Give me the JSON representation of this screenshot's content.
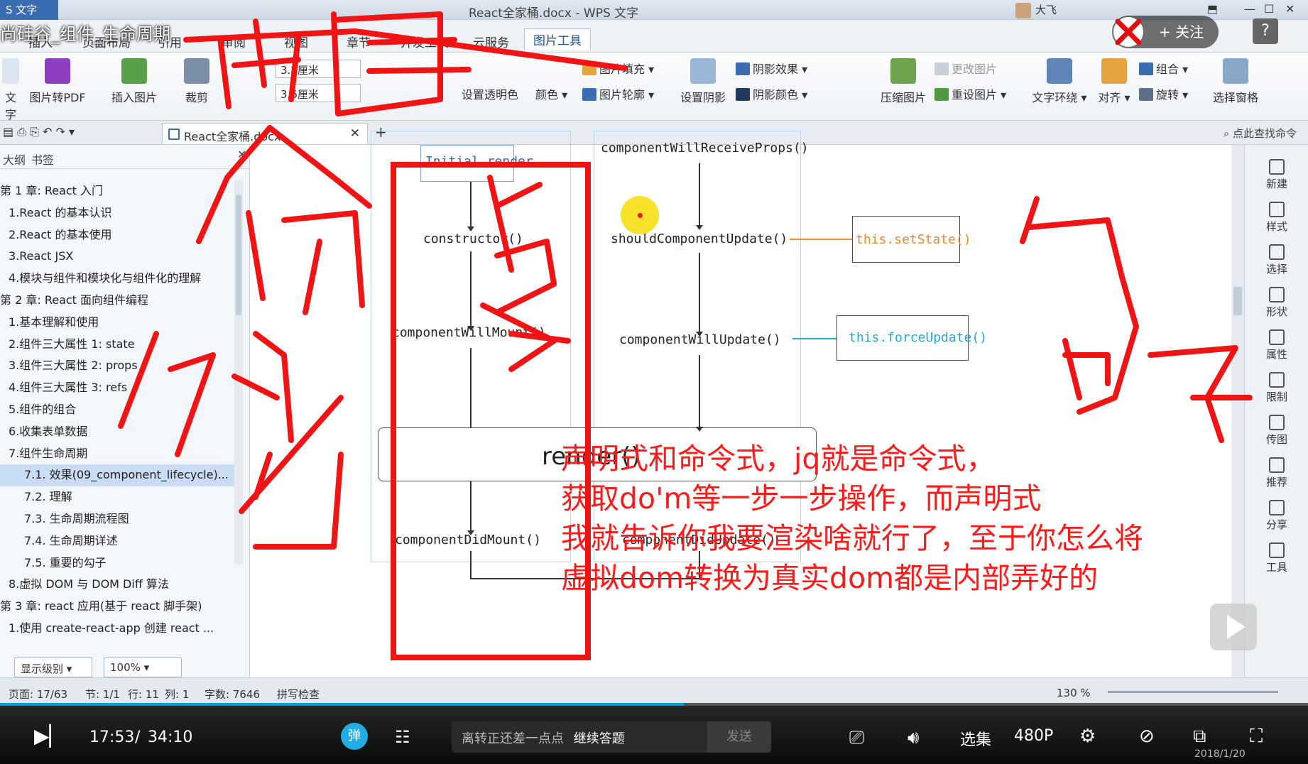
{
  "app": {
    "app_button": "S 文字",
    "doc_title": "React全家桶.docx - WPS 文字",
    "user_name": "大飞",
    "video_title": "尚硅谷_组件_生命周期",
    "follow_label": "+ 关注",
    "help_label": "?"
  },
  "menu_tabs": [
    {
      "label": "插入"
    },
    {
      "label": "页面布局"
    },
    {
      "label": "引用"
    },
    {
      "label": "审阅"
    },
    {
      "label": "视图"
    },
    {
      "label": "章节"
    },
    {
      "label": "开发工具"
    },
    {
      "label": "云服务"
    },
    {
      "label": "图片工具"
    }
  ],
  "ribbon": {
    "pdf": "图片转PDF",
    "insert_pic": "插入图片",
    "crop": "裁剪",
    "height_value": "3.8厘米",
    "width_value": "3.6厘米",
    "fill": "图片填充",
    "transparent": "设置透明色",
    "color": "颜色",
    "outline": "图片轮廓",
    "shadow": "设置阴影",
    "shadow_effect": "阴影效果",
    "shadow_color": "阴影颜色",
    "compress": "压缩图片",
    "change_pic": "更改图片",
    "reset_pic": "重设图片",
    "wrap": "文字环绕",
    "align": "对齐",
    "group": "组合",
    "rotate": "旋转",
    "select_pane": "选择窗格",
    "text_left": "文字"
  },
  "tabstrip": {
    "doc_tab": "React全家桶.docx",
    "find_cmd": "点此查找命令"
  },
  "nav": {
    "tab_outline": "大纲",
    "tab_bookmark": "书签",
    "items": [
      {
        "label": "第 1 章:  React 入门"
      },
      {
        "label": "1.React 的基本认识"
      },
      {
        "label": "2.React 的基本使用"
      },
      {
        "label": "3.React JSX"
      },
      {
        "label": "4.模块与组件和模块化与组件化的理解"
      },
      {
        "label": "第 2 章:  React 面向组件编程"
      },
      {
        "label": "1.基本理解和使用"
      },
      {
        "label": "2.组件三大属性 1: state"
      },
      {
        "label": "3.组件三大属性 2: props"
      },
      {
        "label": "4.组件三大属性 3: refs"
      },
      {
        "label": "5.组件的组合"
      },
      {
        "label": "6.收集表单数据"
      },
      {
        "label": "7.组件生命周期"
      },
      {
        "label": "7.1. 效果(09_component_lifecycle)..."
      },
      {
        "label": "7.2. 理解"
      },
      {
        "label": "7.3. 生命周期流程图"
      },
      {
        "label": "7.4. 生命周期详述"
      },
      {
        "label": "7.5. 重要的勾子"
      },
      {
        "label": "8.虚拟 DOM 与 DOM Diff 算法"
      },
      {
        "label": "第 3 章:  react 应用(基于 react 脚手架)"
      },
      {
        "label": "1.使用 create-react-app 创建 react ..."
      }
    ],
    "display_level": "显示级别",
    "zoom": "100%"
  },
  "diagram": {
    "initial_render": "Initial render",
    "constructor": "constructor()",
    "will_mount": "componentWillMount()",
    "render": "render()",
    "did_mount": "componentDidMount()",
    "will_receive": "componentWillReceiveProps()",
    "should_update": "shouldComponentUpdate()",
    "will_update": "componentWillUpdate()",
    "did_update": "componentDidUpdate()",
    "set_state": "this.setState()",
    "force_update": "this.forceUpdate()"
  },
  "annotation": {
    "line1": "声明式和命令式，jq就是命令式，",
    "line2": "获取do'm等一步一步操作，而声明式",
    "line3": "我就告诉你我要渲染啥就行了，至于你怎么将",
    "line4": "虚拟dom转换为真实dom都是内部弄好的"
  },
  "right_tools": [
    {
      "label": "新建"
    },
    {
      "label": "样式"
    },
    {
      "label": "选择"
    },
    {
      "label": "形状"
    },
    {
      "label": "属性"
    },
    {
      "label": "限制"
    },
    {
      "label": "传图"
    },
    {
      "label": "推荐"
    },
    {
      "label": "分享"
    },
    {
      "label": "工具"
    }
  ],
  "status": {
    "page": "页面: 17/63",
    "section": "节: 1/1",
    "row": "行: 11",
    "col": "列: 1",
    "words": "字数: 7646",
    "spell": "拼写检查",
    "zoom": "130 %"
  },
  "player": {
    "time_current": "17:53",
    "time_sep": "/",
    "time_total": "34:10",
    "progress_fraction": 0.523,
    "danmu_btn": "弹",
    "danmu_placeholder": "离转正还差一点点",
    "danmu_link": "继续答题",
    "send": "发送",
    "episodes": "选集",
    "quality": "480P",
    "date": "2018/1/20"
  },
  "colors": {
    "accent_blue": "#00a1d6",
    "annotation_red": "#ff1a1a",
    "ribbon_bg": "#edf1f6"
  }
}
